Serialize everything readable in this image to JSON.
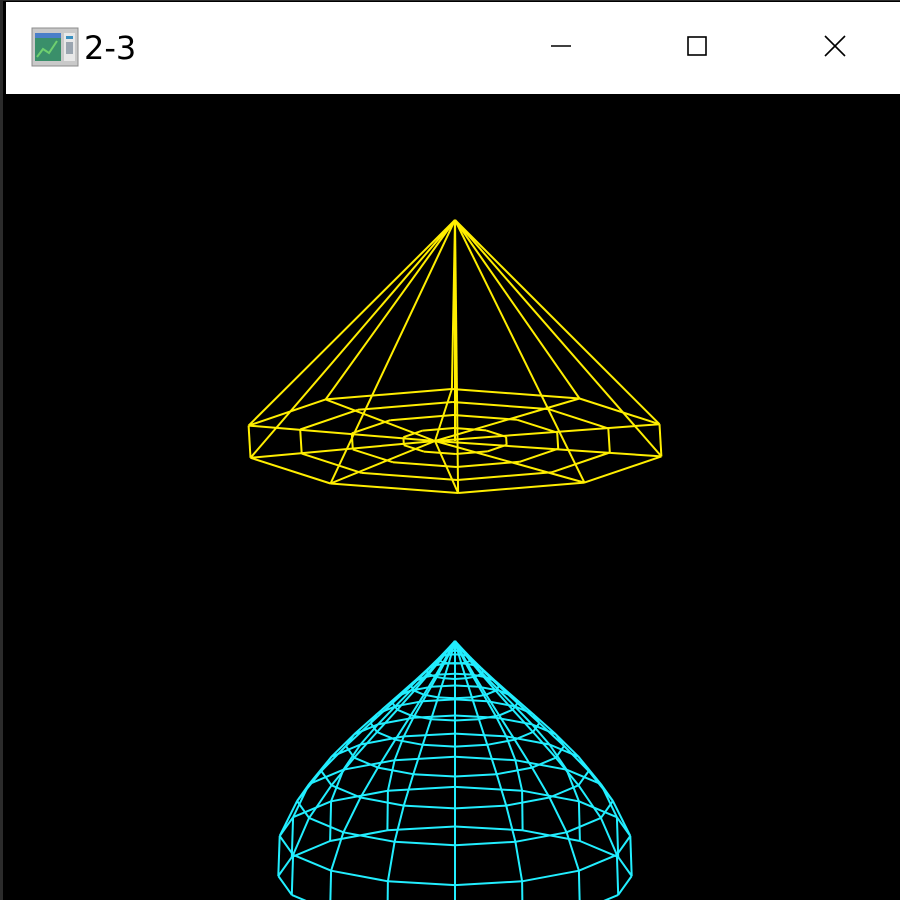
{
  "window": {
    "title": "2-3",
    "icon": "app-window-icon",
    "controls": {
      "minimize": "minimize-icon",
      "maximize": "maximize-icon",
      "close": "close-icon"
    }
  },
  "scene": {
    "background": "#000000",
    "objects": [
      {
        "name": "wire-cone",
        "color": "#ffee00"
      },
      {
        "name": "wire-sphere",
        "color": "#22eeff"
      }
    ]
  }
}
